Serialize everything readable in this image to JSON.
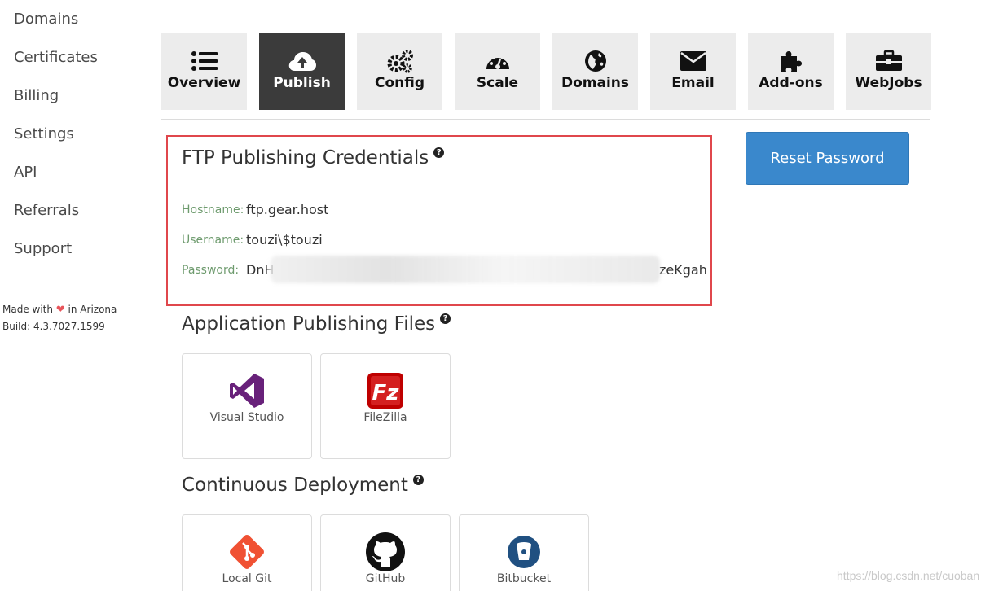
{
  "sidebar": {
    "items": [
      {
        "label": "Domains"
      },
      {
        "label": "Certificates"
      },
      {
        "label": "Billing"
      },
      {
        "label": "Settings"
      },
      {
        "label": "API"
      },
      {
        "label": "Referrals"
      },
      {
        "label": "Support"
      }
    ],
    "footer": {
      "made_prefix": "Made with",
      "made_suffix": "in Arizona",
      "build": "Build: 4.3.7027.1599"
    }
  },
  "tabs": [
    {
      "label": "Overview",
      "icon": "list-icon",
      "active": false
    },
    {
      "label": "Publish",
      "icon": "cloud-upload-icon",
      "active": true
    },
    {
      "label": "Config",
      "icon": "gears-icon",
      "active": false
    },
    {
      "label": "Scale",
      "icon": "dashboard-icon",
      "active": false
    },
    {
      "label": "Domains",
      "icon": "globe-icon",
      "active": false
    },
    {
      "label": "Email",
      "icon": "envelope-icon",
      "active": false
    },
    {
      "label": "Add-ons",
      "icon": "puzzle-icon",
      "active": false
    },
    {
      "label": "WebJobs",
      "icon": "briefcase-icon",
      "active": false
    }
  ],
  "ftp": {
    "title": "FTP Publishing Credentials",
    "help": "?",
    "hostname_label": "Hostname:",
    "hostname_value": "ftp.gear.host",
    "username_label": "Username:",
    "username_value": "touzi\\$touzi",
    "password_label": "Password:",
    "password_prefix": "DnH",
    "password_suffix": "zeKgah",
    "reset_button": "Reset Password"
  },
  "app_publishing": {
    "title": "Application Publishing Files",
    "help": "?",
    "cards": [
      {
        "label": "Visual Studio"
      },
      {
        "label": "FileZilla"
      }
    ]
  },
  "continuous_deployment": {
    "title": "Continuous Deployment",
    "help": "?",
    "cards": [
      {
        "label": "Local Git"
      },
      {
        "label": "GitHub"
      },
      {
        "label": "Bitbucket"
      }
    ]
  },
  "watermark": "https://blog.csdn.net/cuoban",
  "colors": {
    "accent_button": "#3a88cc",
    "active_tab": "#3b3b3b",
    "tab_bg": "#ececec",
    "highlight_border": "#e0474c",
    "label_green": "#6e9b6e"
  }
}
